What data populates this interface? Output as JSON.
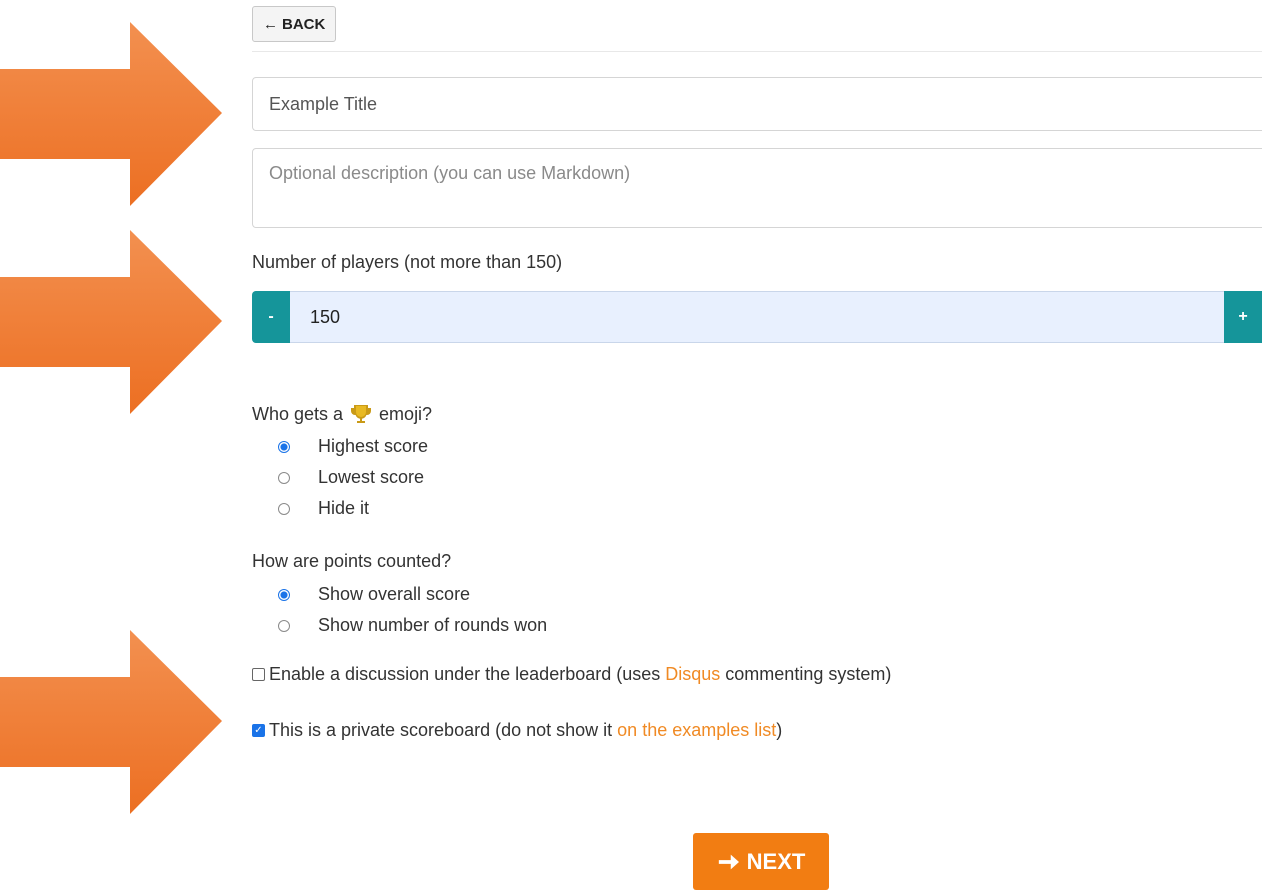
{
  "header": {
    "back_label": "BACK",
    "back_icon": "arrow-left-icon"
  },
  "form": {
    "title_value": "Example Title",
    "description_placeholder": "Optional description (you can use Markdown)",
    "players_label": "Number of players (not more than 150)",
    "players": {
      "minus_label": "-",
      "value": "150",
      "plus_label": "+"
    },
    "trophy_question_prefix": "Who gets a",
    "trophy_question_suffix": "emoji?",
    "trophy_options": [
      {
        "label": "Highest score",
        "checked": true
      },
      {
        "label": "Lowest score",
        "checked": false
      },
      {
        "label": "Hide it",
        "checked": false
      }
    ],
    "points_question": "How are points counted?",
    "points_options": [
      {
        "label": "Show overall score",
        "checked": true
      },
      {
        "label": "Show number of rounds won",
        "checked": false
      }
    ],
    "discussion": {
      "checked": false,
      "text_before": "Enable a discussion under the leaderboard (uses ",
      "link": "Disqus",
      "text_after": " commenting system)"
    },
    "private": {
      "checked": true,
      "text_before": "This is a private scoreboard (do not show it ",
      "link": "on the examples list",
      "text_after": ")"
    }
  },
  "footer": {
    "next_label": "NEXT",
    "next_icon": "arrow-right-icon"
  },
  "colors": {
    "accent": "#f27d12",
    "teal": "#15959a",
    "link": "#f08a24",
    "annotation_arrow": "#f07f35"
  }
}
